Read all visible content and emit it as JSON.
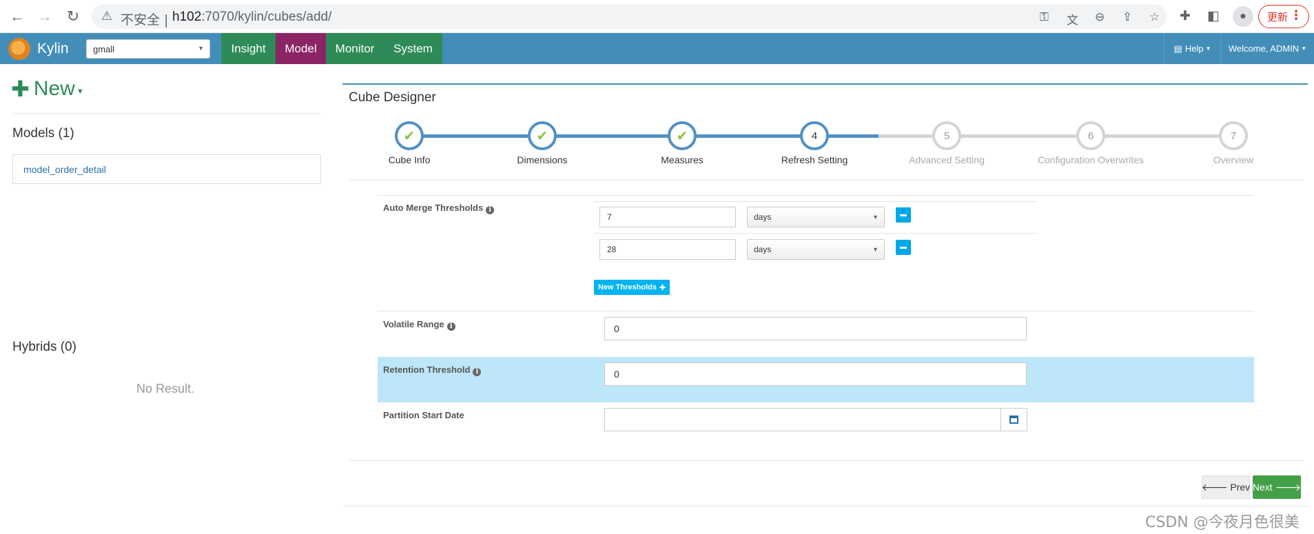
{
  "browser": {
    "back_icon": "back-arrow-icon",
    "forward_icon": "forward-arrow-icon",
    "reload_icon": "reload-icon",
    "security_warning": "不安全",
    "url_host": "h102",
    "url_rest": ":7070/kylin/cubes/add/",
    "update_label": "更新"
  },
  "app": {
    "brand": "Kylin",
    "project": "gmall",
    "tabs": [
      {
        "label": "Insight"
      },
      {
        "label": "Model"
      },
      {
        "label": "Monitor"
      },
      {
        "label": "System"
      }
    ],
    "active_tab": "Model",
    "help_label": "Help",
    "user_label": "Welcome, ADMIN",
    "colors": {
      "nav": "#438eb9",
      "tab_green": "#2e8b57",
      "tab_active": "#8b2565"
    }
  },
  "sidebar": {
    "new_label": "New",
    "models_title": "Models (1)",
    "models": [
      "model_order_detail"
    ],
    "hybrids_title": "Hybrids (0)",
    "hybrids_empty": "No Result."
  },
  "designer": {
    "title": "Cube Designer",
    "steps": [
      {
        "num": "1",
        "label": "Cube Info",
        "state": "done"
      },
      {
        "num": "2",
        "label": "Dimensions",
        "state": "done"
      },
      {
        "num": "3",
        "label": "Measures",
        "state": "done"
      },
      {
        "num": "4",
        "label": "Refresh Setting",
        "state": "current"
      },
      {
        "num": "5",
        "label": "Advanced Setting",
        "state": "todo"
      },
      {
        "num": "6",
        "label": "Configuration Overwrites",
        "state": "todo"
      },
      {
        "num": "7",
        "label": "Overview",
        "state": "todo"
      }
    ],
    "form": {
      "auto_merge_label": "Auto Merge Thresholds",
      "thresholds": [
        {
          "value": "7",
          "unit": "days"
        },
        {
          "value": "28",
          "unit": "days"
        }
      ],
      "new_thresholds_label": "New Thresholds",
      "volatile_label": "Volatile Range",
      "volatile_value": "0",
      "retention_label": "Retention Threshold",
      "retention_value": "0",
      "partition_label": "Partition Start Date",
      "partition_value": ""
    },
    "prev_label": "Prev",
    "next_label": "Next"
  },
  "watermark": "CSDN @今夜月色很美"
}
